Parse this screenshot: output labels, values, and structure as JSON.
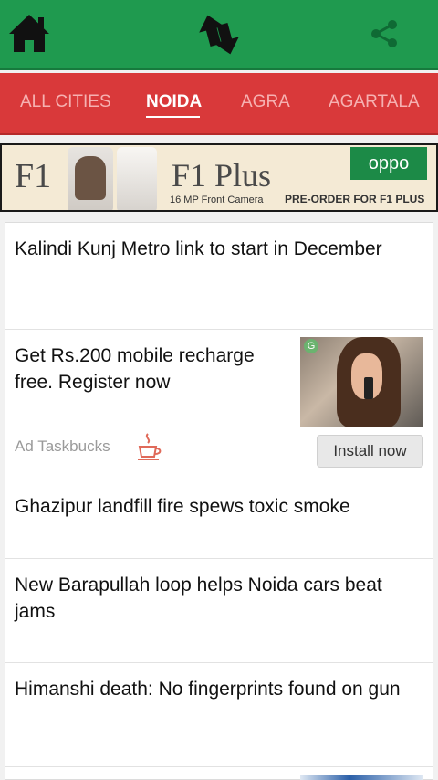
{
  "header": {
    "icons": {
      "home": "home-icon",
      "sync": "sync-icon",
      "share": "share-icon"
    },
    "colors": {
      "bar": "#1f9a4f",
      "icon": "#111111",
      "share": "#0f6a34"
    }
  },
  "tabs": [
    {
      "label": "ALL CITIES",
      "active": false
    },
    {
      "label": "NOIDA",
      "active": true
    },
    {
      "label": "AGRA",
      "active": false
    },
    {
      "label": "AGARTALA",
      "active": false
    }
  ],
  "banner": {
    "model": "F1",
    "model_plus": "F1 Plus",
    "camera": "16 MP Front Camera",
    "cta": "PRE-ORDER FOR F1 PLUS",
    "brand": "oppo"
  },
  "feed": [
    {
      "title": "Kalindi Kunj Metro link to start in December"
    },
    {
      "ad": true,
      "title": "Get Rs.200 mobile recharge free. Register now",
      "label": "Ad Taskbucks",
      "button": "Install now"
    },
    {
      "title": "Ghazipur landfill fire spews toxic smoke"
    },
    {
      "title": "New Barapullah loop helps Noida cars beat jams"
    },
    {
      "title": "Himanshi death: No fingerprints found on gun"
    }
  ]
}
